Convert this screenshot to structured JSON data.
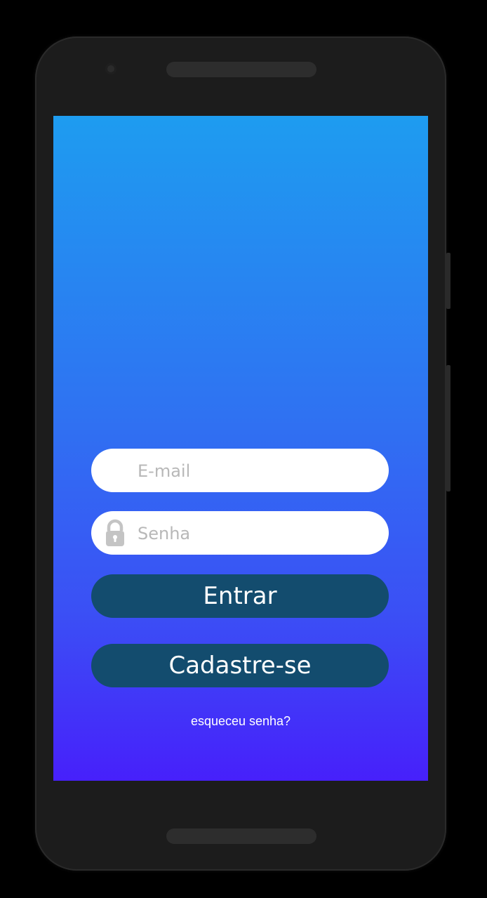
{
  "login": {
    "email_placeholder": "E-mail",
    "password_placeholder": "Senha",
    "login_button": "Entrar",
    "signup_button": "Cadastre-se",
    "forgot_password": "esqueceu senha?"
  },
  "icons": {
    "password": "lock-icon"
  },
  "colors": {
    "gradient_top": "#1e9cf0",
    "gradient_bottom": "#4720fb",
    "button": "#134c6e",
    "field": "#ffffff"
  }
}
